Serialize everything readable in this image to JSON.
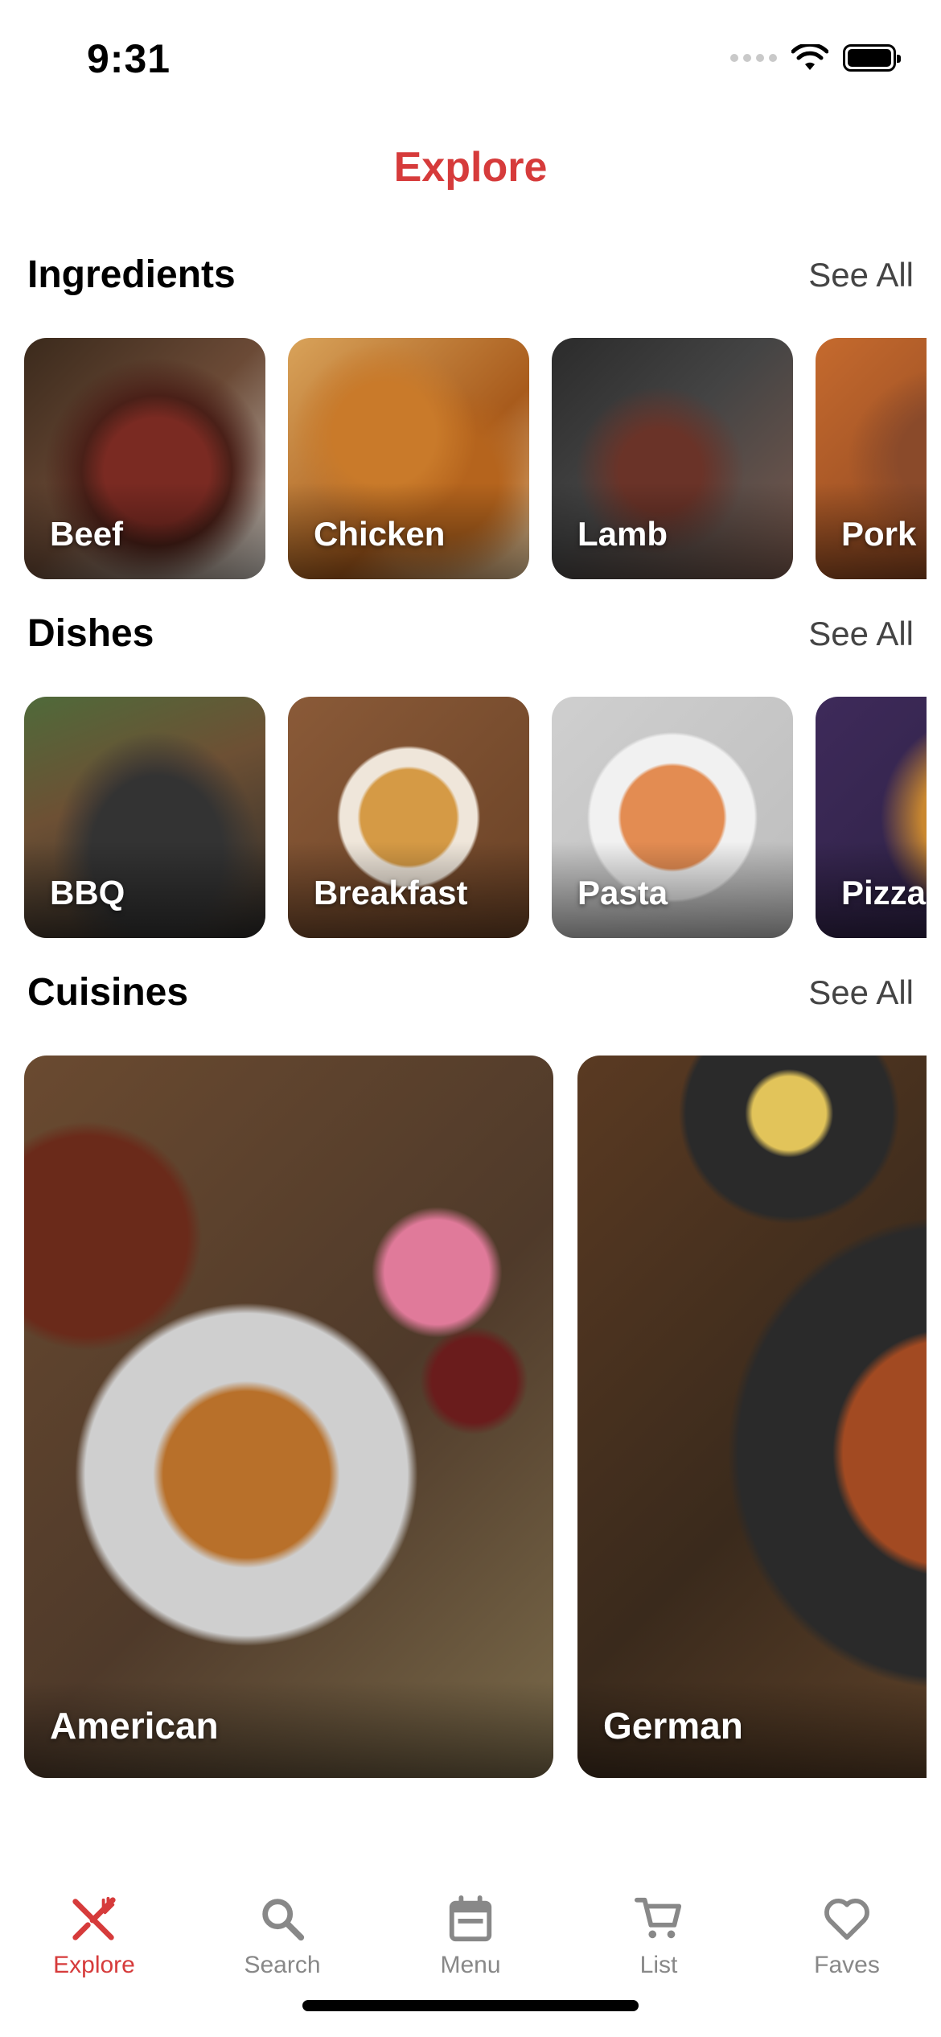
{
  "status_bar": {
    "time": "9:31"
  },
  "header": {
    "title": "Explore"
  },
  "sections": [
    {
      "title": "Ingredients",
      "see_all": "See All",
      "items": [
        "Beef",
        "Chicken",
        "Lamb",
        "Pork"
      ]
    },
    {
      "title": "Dishes",
      "see_all": "See All",
      "items": [
        "BBQ",
        "Breakfast",
        "Pasta",
        "Pizza"
      ]
    },
    {
      "title": "Cuisines",
      "see_all": "See All",
      "items": [
        "American",
        "German"
      ]
    }
  ],
  "tab_bar": {
    "active": "Explore",
    "items": [
      {
        "label": "Explore",
        "icon": "fork-knife-icon"
      },
      {
        "label": "Search",
        "icon": "search-icon"
      },
      {
        "label": "Menu",
        "icon": "calendar-icon"
      },
      {
        "label": "List",
        "icon": "cart-icon"
      },
      {
        "label": "Faves",
        "icon": "heart-icon"
      }
    ]
  },
  "colors": {
    "accent": "#d63b3b",
    "inactive": "#888888"
  }
}
